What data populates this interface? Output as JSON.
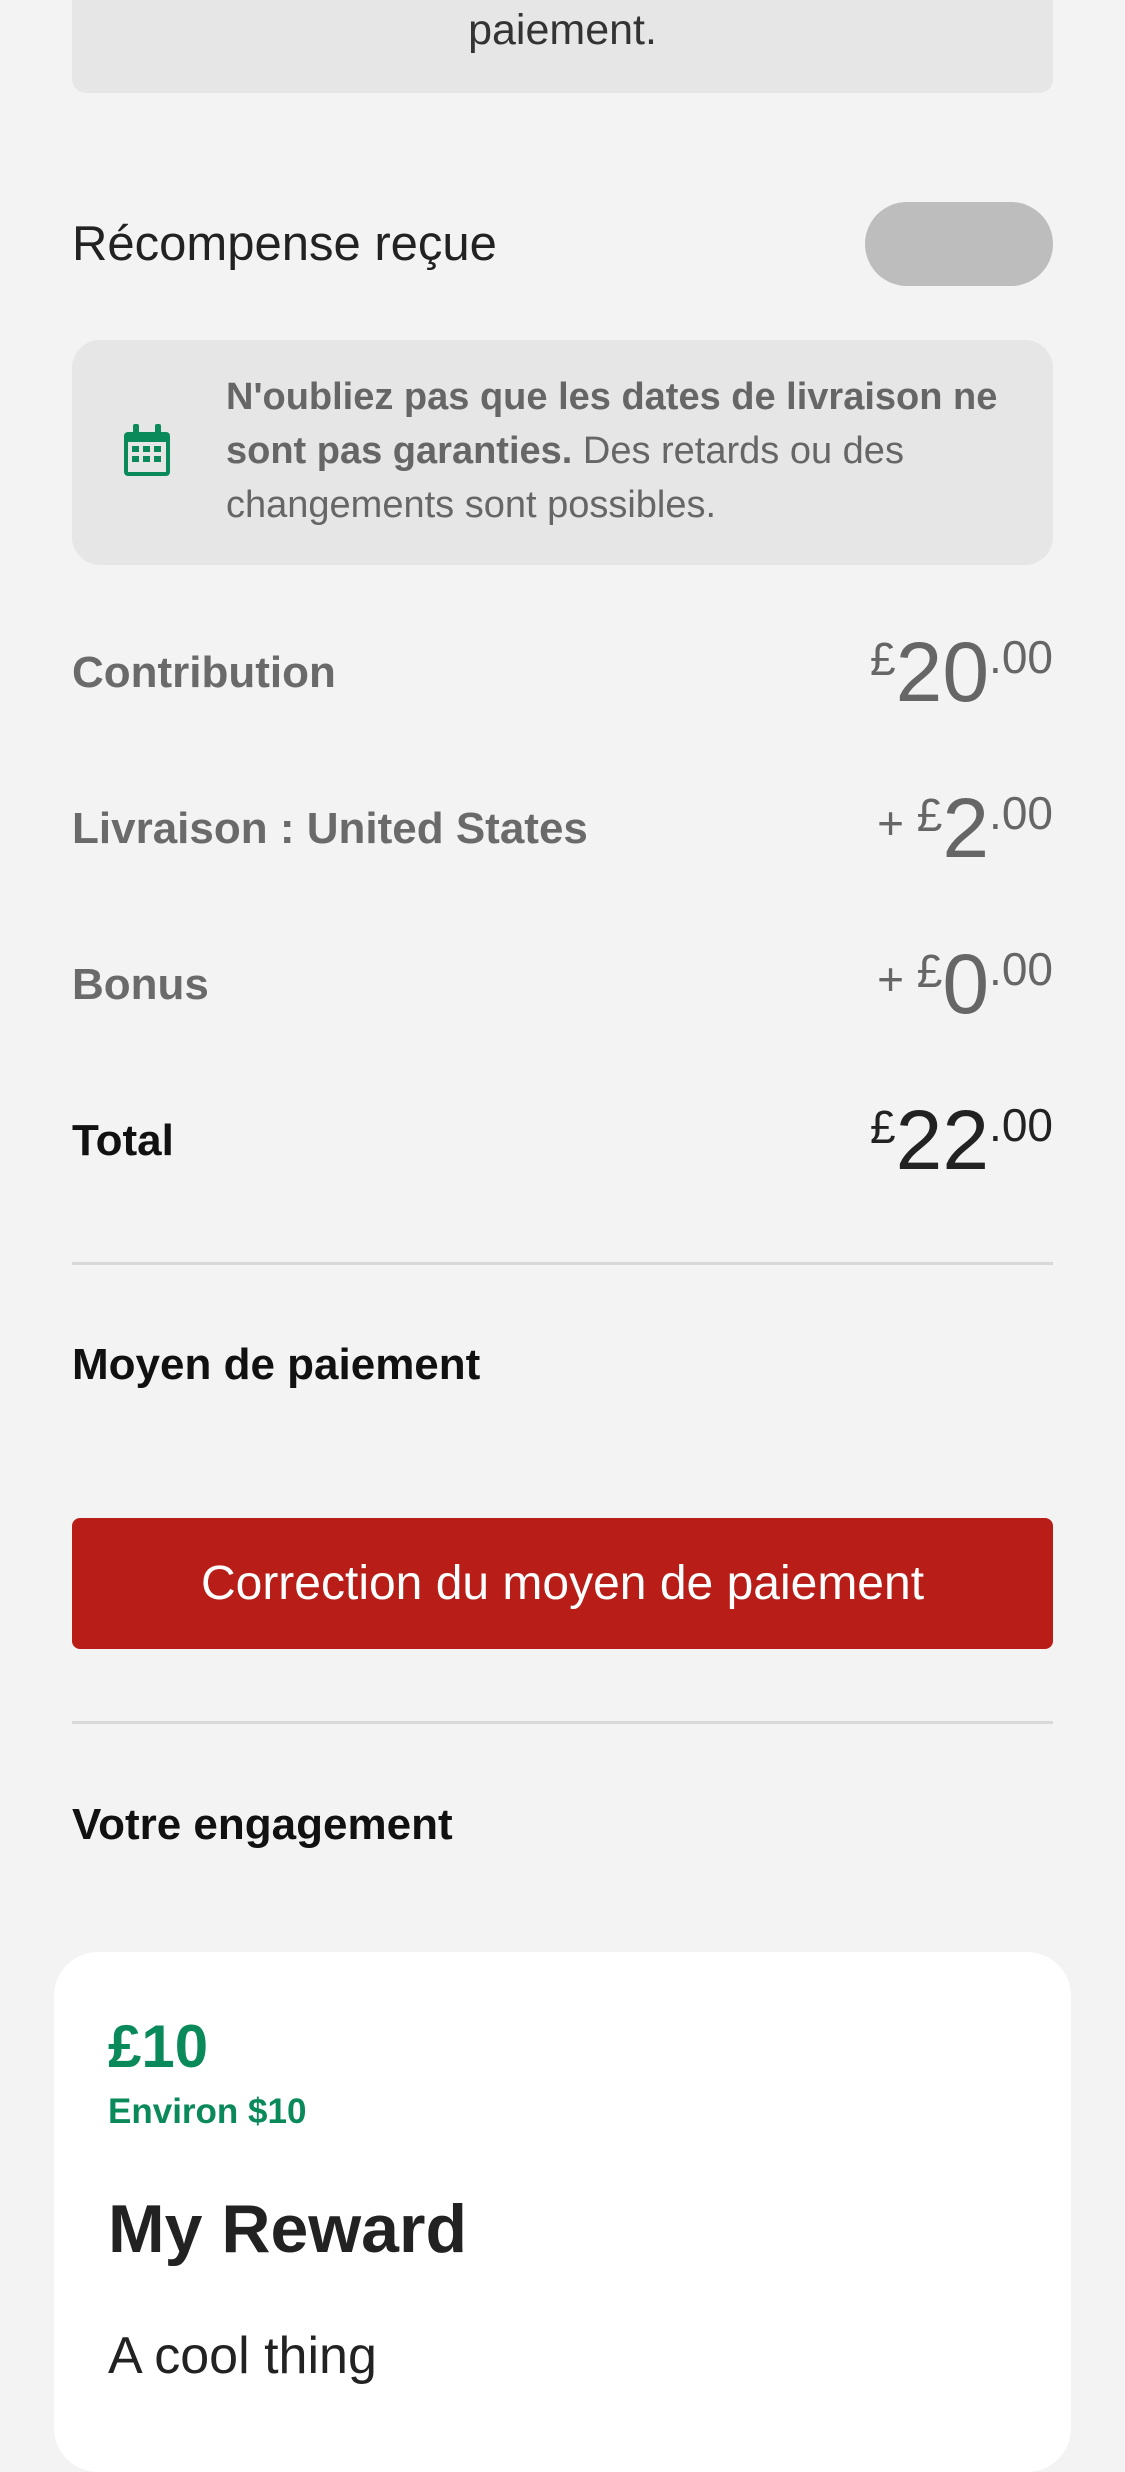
{
  "notice_top": {
    "text": "paiement."
  },
  "reward_received": {
    "label": "Récompense reçue"
  },
  "delivery_info": {
    "bold_text": "N'oubliez pas que les dates de livraison ne sont pas garanties.",
    "rest_text": " Des retards ou des changements sont possibles."
  },
  "summary": {
    "contribution": {
      "label": "Contribution",
      "prefix": "",
      "currency": "£",
      "whole": "20",
      "cents": ".00"
    },
    "shipping": {
      "label": "Livraison : United States",
      "prefix": "+ ",
      "currency": "£",
      "whole": "2",
      "cents": ".00"
    },
    "bonus": {
      "label": "Bonus",
      "prefix": "+ ",
      "currency": "£",
      "whole": "0",
      "cents": ".00"
    },
    "total": {
      "label": "Total",
      "prefix": "",
      "currency": "£",
      "whole": "22",
      "cents": ".00"
    }
  },
  "payment": {
    "title": "Moyen de paiement",
    "fix_button": "Correction du moyen de paiement"
  },
  "pledge": {
    "title": "Votre engagement",
    "price": "£10",
    "approx": "Environ $10",
    "reward_title": "My Reward",
    "reward_desc": "A cool thing"
  },
  "colors": {
    "accent_green": "#0a8a5a",
    "error_red": "#b81e17"
  },
  "icons": {
    "calendar": "calendar-icon"
  }
}
